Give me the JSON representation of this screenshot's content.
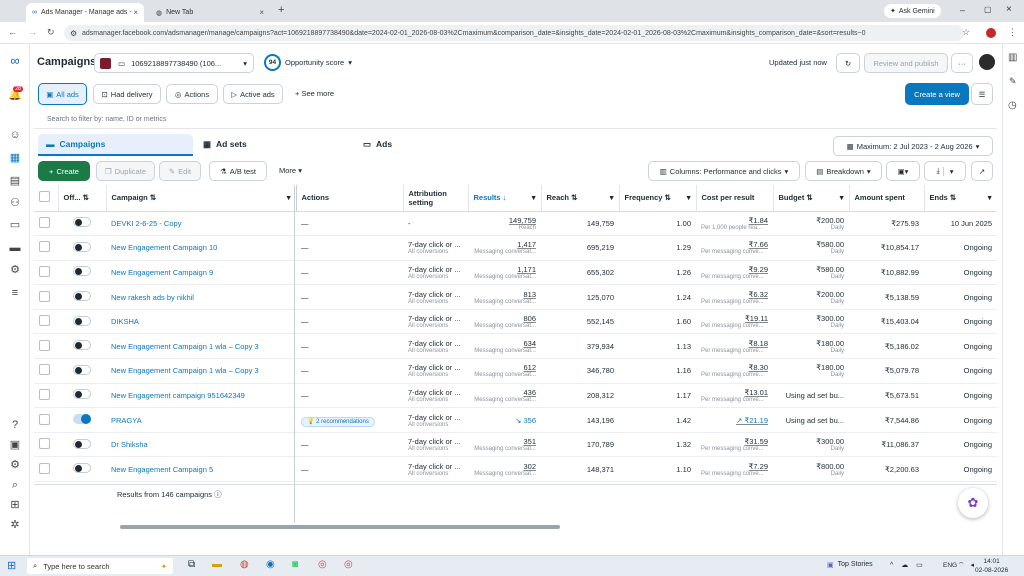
{
  "browser": {
    "tabs": [
      {
        "label": "Ads Manager - Manage ads - C",
        "active": true
      },
      {
        "label": "New Tab",
        "active": false
      }
    ],
    "new_tab": "+",
    "ask_gemini": "Ask Gemini",
    "url": "adsmanager.facebook.com/adsmanager/manage/campaigns?act=1069218897738490&date=2024-02-01_2026-08-03%2Cmaximum&comparison_date=&insights_date=2024-02-01_2026-08-03%2Cmaximum&insights_comparison_date=&sort=results~0"
  },
  "header": {
    "title": "Campaigns",
    "account": "1069218897738490 (106...",
    "opportunity_score": "94",
    "opportunity_label": "Opportunity score",
    "updated": "Updated just now",
    "review_publish": "Review and publish",
    "more": "···"
  },
  "filters": {
    "all_ads": "All ads",
    "had_delivery": "Had delivery",
    "actions": "Actions",
    "active_ads": "Active ads",
    "see_more": "See more",
    "create_view": "Create a view",
    "search_placeholder": "Search to filter by: name, ID or metrics"
  },
  "tabs": {
    "campaigns": "Campaigns",
    "ad_sets": "Ad sets",
    "ads": "Ads",
    "date_range": "Maximum: 2 Jul 2023 - 2 Aug 2026"
  },
  "toolbar": {
    "create": "Create",
    "duplicate": "Duplicate",
    "edit": "Edit",
    "ab_test": "A/B test",
    "more": "More",
    "columns": "Columns: Performance and clicks",
    "breakdown": "Breakdown"
  },
  "columns": {
    "off": "Off...",
    "campaign": "Campaign",
    "actions": "Actions",
    "attribution": "Attribution setting",
    "results": "Results",
    "reach": "Reach",
    "frequency": "Frequency",
    "cost_per_result": "Cost per result",
    "budget": "Budget",
    "amount_spent": "Amount spent",
    "ends": "Ends"
  },
  "rows": [
    {
      "name": "DEVKI 2-6-25 - Copy",
      "on": false,
      "actions": "—",
      "attr": "-",
      "attr_sub": "",
      "results": "149,759",
      "results_sub": "Reach",
      "reach": "149,759",
      "freq": "1.00",
      "cost": "₹1.84",
      "cost_sub": "Per 1,000 people rea...",
      "budget": "₹200.00",
      "budget_sub": "Daily",
      "spent": "₹275.93",
      "ends": "10 Jun 2025"
    },
    {
      "name": "New Engagement Campaign 10",
      "on": false,
      "actions": "—",
      "attr": "7-day click or ...",
      "attr_sub": "All conversions",
      "results": "1,417",
      "results_sub": "Messaging conversat...",
      "reach": "695,219",
      "freq": "1.29",
      "cost": "₹7.66",
      "cost_sub": "Per messaging conve...",
      "budget": "₹580.00",
      "budget_sub": "Daily",
      "spent": "₹10,854.17",
      "ends": "Ongoing"
    },
    {
      "name": "New Engagement Campaign 9",
      "on": false,
      "actions": "—",
      "attr": "7-day click or ...",
      "attr_sub": "All conversions",
      "results": "1,171",
      "results_sub": "Messaging conversat...",
      "reach": "655,302",
      "freq": "1.26",
      "cost": "₹9.29",
      "cost_sub": "Per messaging conve...",
      "budget": "₹580.00",
      "budget_sub": "Daily",
      "spent": "₹10,882.99",
      "ends": "Ongoing"
    },
    {
      "name": "New rakesh ads by nikhil",
      "on": false,
      "actions": "—",
      "attr": "7-day click or ...",
      "attr_sub": "All conversions",
      "results": "813",
      "results_sub": "Messaging conversat...",
      "reach": "125,070",
      "freq": "1.24",
      "cost": "₹6.32",
      "cost_sub": "Per messaging conve...",
      "budget": "₹200.00",
      "budget_sub": "Daily",
      "spent": "₹5,138.59",
      "ends": "Ongoing"
    },
    {
      "name": "DIKSHA",
      "on": false,
      "actions": "—",
      "attr": "7-day click or ...",
      "attr_sub": "All conversions",
      "results": "806",
      "results_sub": "Messaging conversat...",
      "reach": "552,145",
      "freq": "1.60",
      "cost": "₹19.11",
      "cost_sub": "Per messaging conve...",
      "budget": "₹300.00",
      "budget_sub": "Daily",
      "spent": "₹15,403.04",
      "ends": "Ongoing"
    },
    {
      "name": "New Engagement Campaign 1 wla – Copy 3",
      "on": false,
      "actions": "—",
      "attr": "7-day click or ...",
      "attr_sub": "All conversions",
      "results": "634",
      "results_sub": "Messaging conversat...",
      "reach": "379,934",
      "freq": "1.13",
      "cost": "₹8.18",
      "cost_sub": "Per messaging conve...",
      "budget": "₹180.00",
      "budget_sub": "Daily",
      "spent": "₹5,186.02",
      "ends": "Ongoing"
    },
    {
      "name": "New Engagement Campaign 1 wla – Copy 3",
      "on": false,
      "actions": "—",
      "attr": "7-day click or ...",
      "attr_sub": "All conversions",
      "results": "612",
      "results_sub": "Messaging conversat...",
      "reach": "346,780",
      "freq": "1.16",
      "cost": "₹8.30",
      "cost_sub": "Per messaging conve...",
      "budget": "₹180.00",
      "budget_sub": "Daily",
      "spent": "₹5,079.78",
      "ends": "Ongoing"
    },
    {
      "name": "New Engagement campaign 951642349",
      "on": false,
      "actions": "—",
      "attr": "7-day click or ...",
      "attr_sub": "All conversions",
      "results": "436",
      "results_sub": "Messaging conversat...",
      "reach": "208,312",
      "freq": "1.17",
      "cost": "₹13.01",
      "cost_sub": "Per messaging conve...",
      "budget": "Using ad set bu...",
      "budget_sub": "",
      "spent": "₹5,673.51",
      "ends": "Ongoing"
    },
    {
      "name": "PRAGYA",
      "on": true,
      "actions": "2 recommendations",
      "attr": "7-day click or ...",
      "attr_sub": "All conversions",
      "results": "↘ 356",
      "results_sub": "",
      "reach": "143,196",
      "freq": "1.42",
      "cost": "↗ ₹21.19",
      "cost_sub": "",
      "budget": "Using ad set bu...",
      "budget_sub": "",
      "spent": "₹7,544.86",
      "ends": "Ongoing"
    },
    {
      "name": "Dr Shiksha",
      "on": false,
      "actions": "—",
      "attr": "7-day click or ...",
      "attr_sub": "All conversions",
      "results": "351",
      "results_sub": "Messaging conversat...",
      "reach": "170,789",
      "freq": "1.32",
      "cost": "₹31.59",
      "cost_sub": "Per messaging conve...",
      "budget": "₹300.00",
      "budget_sub": "Daily",
      "spent": "₹11,086.37",
      "ends": "Ongoing"
    },
    {
      "name": "New Engagement Campaign 5",
      "on": false,
      "actions": "—",
      "attr": "7-day click or ...",
      "attr_sub": "All conversions",
      "results": "302",
      "results_sub": "Messaging conversat...",
      "reach": "148,371",
      "freq": "1.10",
      "cost": "₹7.29",
      "cost_sub": "Per messaging conve...",
      "budget": "₹800.00",
      "budget_sub": "Daily",
      "spent": "₹2,200.63",
      "ends": "Ongoing"
    }
  ],
  "footer": {
    "results_from": "Results from 146 campaigns"
  },
  "taskbar": {
    "search_placeholder": "Type here to search",
    "top_stories": "Top Stories",
    "lang": "ENG",
    "time": "14:01",
    "date": "02-08-2026"
  },
  "notifications_badge": "28",
  "colors": {
    "accent": "#0a78be",
    "create_green": "#1b7a46"
  }
}
